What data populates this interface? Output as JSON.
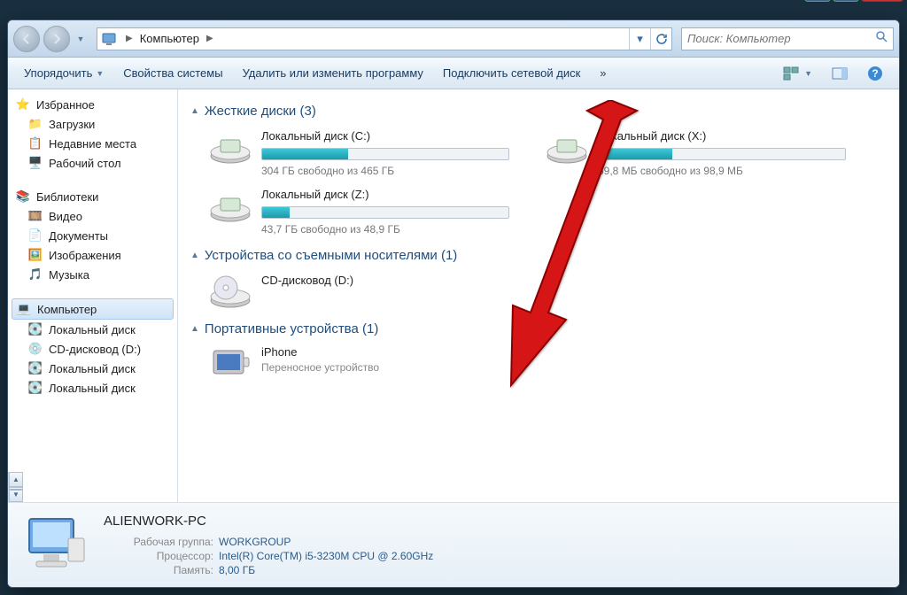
{
  "breadcrumb": {
    "root": "Компьютер"
  },
  "search": {
    "placeholder": "Поиск: Компьютер"
  },
  "toolbar": {
    "organize": "Упорядочить",
    "sysprops": "Свойства системы",
    "uninstall": "Удалить или изменить программу",
    "mapdrive": "Подключить сетевой диск",
    "more": "»"
  },
  "sidebar": {
    "fav": "Избранное",
    "downloads": "Загрузки",
    "recent": "Недавние места",
    "desktop": "Рабочий стол",
    "libraries": "Библиотеки",
    "video": "Видео",
    "documents": "Документы",
    "pictures": "Изображения",
    "music": "Музыка",
    "computer": "Компьютер",
    "localdisk1": "Локальный диск",
    "cddrive": "CD-дисковод (D:)",
    "localdisk2": "Локальный диск",
    "localdisk3": "Локальный диск"
  },
  "categories": {
    "hdd": "Жесткие диски (3)",
    "removable": "Устройства со съемными носителями (1)",
    "portable": "Портативные устройства (1)"
  },
  "drives": {
    "c": {
      "name": "Локальный диск (C:)",
      "free": "304 ГБ свободно из 465 ГБ",
      "fillPct": 35
    },
    "x": {
      "name": "Локальный диск (X:)",
      "free": "69,8 МБ свободно из 98,9 МБ",
      "fillPct": 30
    },
    "z": {
      "name": "Локальный диск (Z:)",
      "free": "43,7 ГБ свободно из 48,9 ГБ",
      "fillPct": 11
    },
    "cd": {
      "name": "CD-дисковод (D:)"
    },
    "iphone": {
      "name": "iPhone",
      "sub": "Переносное устройство"
    }
  },
  "status": {
    "name": "ALIENWORK-PC",
    "workgroup_label": "Рабочая группа:",
    "workgroup": "WORKGROUP",
    "cpu_label": "Процессор:",
    "cpu": "Intel(R) Core(TM) i5-3230M CPU @ 2.60GHz",
    "mem_label": "Память:",
    "mem": "8,00 ГБ"
  }
}
